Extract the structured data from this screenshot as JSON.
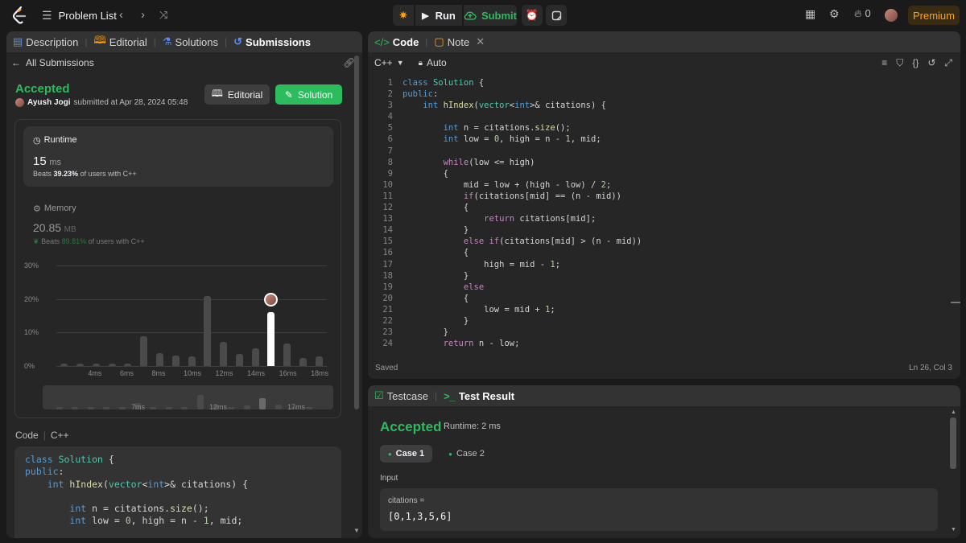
{
  "topbar": {
    "problem_list": "Problem List",
    "run": "Run",
    "submit": "Submit",
    "streak": "0",
    "premium": "Premium"
  },
  "left": {
    "tabs": [
      "Description",
      "Editorial",
      "Solutions",
      "Submissions"
    ],
    "all_submissions": "All Submissions",
    "status": "Accepted",
    "user": "Ayush Jogi",
    "submitted": "submitted at Apr 28, 2024 05:48",
    "editorial_btn": "Editorial",
    "solution_btn": "Solution",
    "runtime": {
      "label": "Runtime",
      "value": "15",
      "unit": "ms",
      "beats_pre": "Beats",
      "beats_pct": "39.23%",
      "beats_post": "of users with C++"
    },
    "memory": {
      "label": "Memory",
      "value": "20.85",
      "unit": "MB",
      "beats_pre": "Beats",
      "beats_pct": "89.81%",
      "beats_post": "of users with C++"
    },
    "code_header": "Code",
    "code_lang": "C++",
    "code_preview": [
      "class Solution {",
      "public:",
      "    int hIndex(vector<int>& citations) {",
      "",
      "        int n = citations.size();",
      "        int low = 0, high = n - 1, mid;"
    ]
  },
  "chart_data": {
    "type": "bar",
    "title": "",
    "xlabel": "",
    "ylabel": "",
    "ylim": [
      0,
      30
    ],
    "y_ticks": [
      "30%",
      "20%",
      "10%",
      "0%"
    ],
    "x_ticks": [
      "4ms",
      "6ms",
      "8ms",
      "10ms",
      "12ms",
      "14ms",
      "16ms",
      "18ms"
    ],
    "categories": [
      "2ms",
      "3ms",
      "4ms",
      "5ms",
      "6ms",
      "7ms",
      "8ms",
      "9ms",
      "10ms",
      "11ms",
      "12ms",
      "13ms",
      "14ms",
      "15ms",
      "16ms",
      "17ms",
      "18ms"
    ],
    "values": [
      0.8,
      0.8,
      0.8,
      0.8,
      0.8,
      8.8,
      3.8,
      3.2,
      2.8,
      20.8,
      7.2,
      3.7,
      5.2,
      16.0,
      6.8,
      2.3,
      2.9
    ],
    "highlighted": "15ms",
    "minimap_labels": [
      "7ms",
      "12ms",
      "17ms"
    ]
  },
  "editor": {
    "tabs": [
      "Code",
      "Note"
    ],
    "lang": "C++",
    "mode": "Auto",
    "saved": "Saved",
    "position": "Ln 26, Col 3",
    "lines": [
      "class Solution {",
      "public:",
      "    int hIndex(vector<int>& citations) {",
      "",
      "        int n = citations.size();",
      "        int low = 0, high = n - 1, mid;",
      "",
      "        while(low <= high)",
      "        {",
      "            mid = low + (high - low) / 2;",
      "            if(citations[mid] == (n - mid))",
      "            {",
      "                return citations[mid];",
      "            }",
      "            else if(citations[mid] > (n - mid))",
      "            {",
      "                high = mid - 1;",
      "            }",
      "            else",
      "            {",
      "                low = mid + 1;",
      "            }",
      "        }",
      "        return n - low;"
    ],
    "line_numbers": [
      "1",
      "2",
      "3",
      "4",
      "5",
      "6",
      "7",
      "8",
      "9",
      "10",
      "11",
      "12",
      "13",
      "14",
      "15",
      "16",
      "17",
      "18",
      "19",
      "20",
      "21",
      "22",
      "23",
      "24"
    ]
  },
  "result": {
    "tabs": [
      "Testcase",
      "Test Result"
    ],
    "status": "Accepted",
    "runtime": "Runtime: 2 ms",
    "cases": [
      "Case 1",
      "Case 2"
    ],
    "input_label": "Input",
    "var_name": "citations =",
    "var_value": "[0,1,3,5,6]"
  },
  "colors": {
    "accent_green": "#2cbb5d",
    "brand_orange": "#ffa116",
    "link_blue": "#0a84ff",
    "bg": "#1a1a1a",
    "panel": "#262626"
  }
}
